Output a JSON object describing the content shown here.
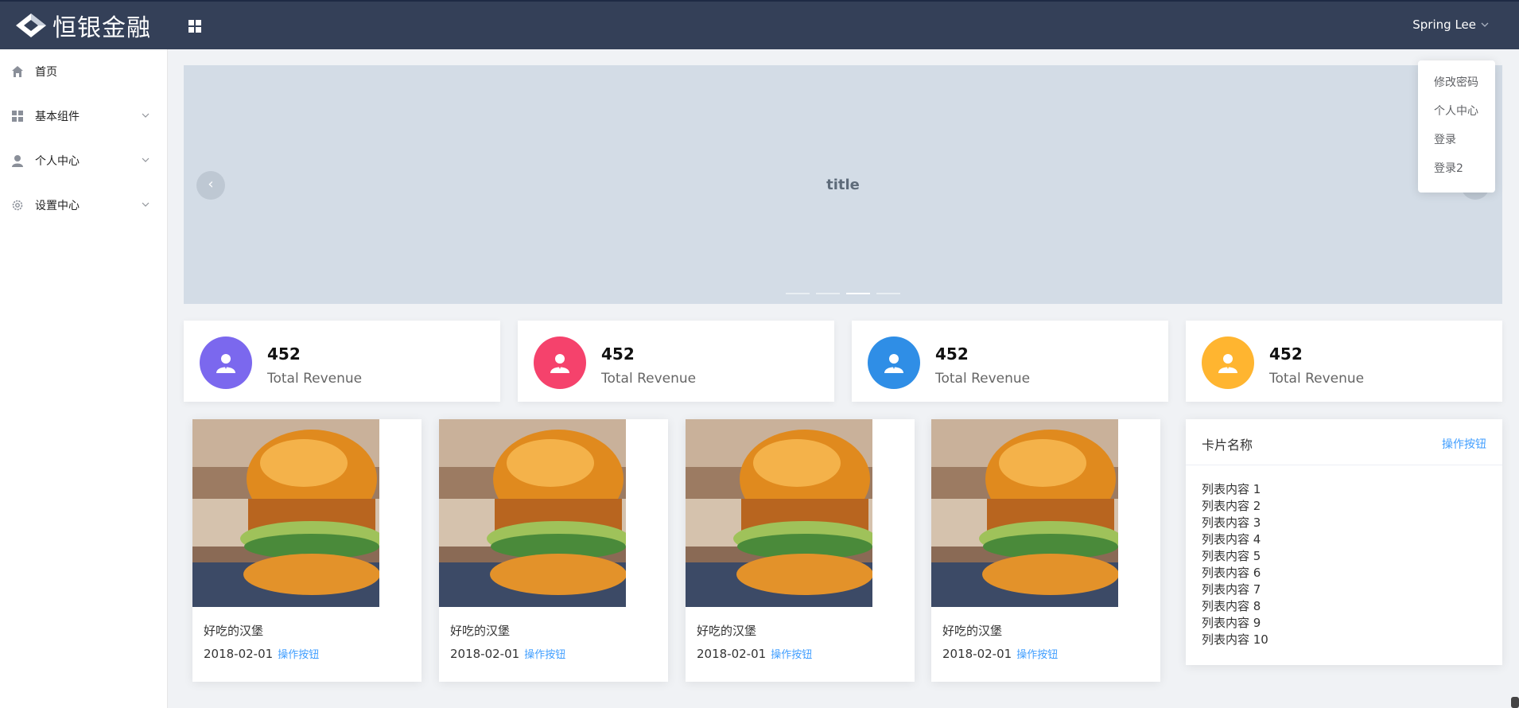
{
  "header": {
    "brand": "恒银金融",
    "user_name": "Spring Lee"
  },
  "user_menu": {
    "items": [
      {
        "label": "修改密码"
      },
      {
        "label": "个人中心"
      },
      {
        "label": "登录"
      },
      {
        "label": "登录2"
      }
    ]
  },
  "sidebar": {
    "items": [
      {
        "label": "首页",
        "icon": "home-icon",
        "expandable": false
      },
      {
        "label": "基本组件",
        "icon": "grid-icon",
        "expandable": true
      },
      {
        "label": "个人中心",
        "icon": "user-icon",
        "expandable": true
      },
      {
        "label": "设置中心",
        "icon": "gear-icon",
        "expandable": true
      }
    ]
  },
  "carousel": {
    "title": "title",
    "slide_count": 4,
    "active_index": 2
  },
  "stats": [
    {
      "value": "452",
      "label": "Total Revenue",
      "color": "#7b68ee"
    },
    {
      "value": "452",
      "label": "Total Revenue",
      "color": "#f5426c"
    },
    {
      "value": "452",
      "label": "Total Revenue",
      "color": "#2f8ee6"
    },
    {
      "value": "452",
      "label": "Total Revenue",
      "color": "#ffb530"
    }
  ],
  "foods": [
    {
      "name": "好吃的汉堡",
      "date": "2018-02-01",
      "action": "操作按钮"
    },
    {
      "name": "好吃的汉堡",
      "date": "2018-02-01",
      "action": "操作按钮"
    },
    {
      "name": "好吃的汉堡",
      "date": "2018-02-01",
      "action": "操作按钮"
    },
    {
      "name": "好吃的汉堡",
      "date": "2018-02-01",
      "action": "操作按钮"
    }
  ],
  "list_card": {
    "title": "卡片名称",
    "action": "操作按钮",
    "items": [
      "列表内容 1",
      "列表内容 2",
      "列表内容 3",
      "列表内容 4",
      "列表内容 5",
      "列表内容 6",
      "列表内容 7",
      "列表内容 8",
      "列表内容 9",
      "列表内容 10"
    ]
  },
  "colors": {
    "topbar": "#344058",
    "link": "#409eff",
    "carousel_bg": "#d3dce6"
  }
}
